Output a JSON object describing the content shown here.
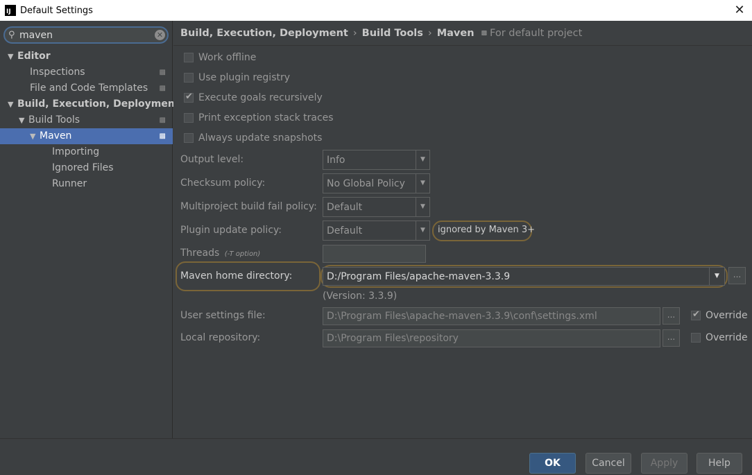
{
  "window": {
    "title": "Default Settings",
    "app_icon": "IJ"
  },
  "search": {
    "value": "maven"
  },
  "tree": [
    {
      "label": "Editor",
      "arrow": "▼",
      "bold": true,
      "indent": 0,
      "proj": false,
      "selected": false
    },
    {
      "label": "Inspections",
      "arrow": "",
      "bold": false,
      "indent": 2,
      "proj": true,
      "selected": false
    },
    {
      "label": "File and Code Templates",
      "arrow": "",
      "bold": false,
      "indent": 2,
      "proj": true,
      "selected": false
    },
    {
      "label": "Build, Execution, Deployment",
      "arrow": "▼",
      "bold": true,
      "indent": 0,
      "proj": false,
      "selected": false
    },
    {
      "label": "Build Tools",
      "arrow": "▼",
      "bold": false,
      "indent": 1,
      "proj": true,
      "selected": false
    },
    {
      "label": "Maven",
      "arrow": "▼",
      "bold": false,
      "indent": 2,
      "proj": true,
      "selected": true
    },
    {
      "label": "Importing",
      "arrow": "",
      "bold": false,
      "indent": 4,
      "proj": false,
      "selected": false
    },
    {
      "label": "Ignored Files",
      "arrow": "",
      "bold": false,
      "indent": 4,
      "proj": false,
      "selected": false
    },
    {
      "label": "Runner",
      "arrow": "",
      "bold": false,
      "indent": 4,
      "proj": false,
      "selected": false
    }
  ],
  "breadcrumb": {
    "part1": "Build, Execution, Deployment",
    "sep": "›",
    "part2": "Build Tools",
    "part3": "Maven",
    "scope": "For default project"
  },
  "checkboxes": {
    "work_offline": {
      "label": "Work offline",
      "checked": false
    },
    "use_plugin_registry": {
      "label": "Use plugin registry",
      "checked": false
    },
    "execute_goals": {
      "label": "Execute goals recursively",
      "checked": true
    },
    "print_exception": {
      "label": "Print exception stack traces",
      "checked": false
    },
    "always_update": {
      "label": "Always update snapshots",
      "checked": false
    }
  },
  "form": {
    "output_level": {
      "label": "Output level:",
      "value": "Info"
    },
    "checksum_policy": {
      "label": "Checksum policy:",
      "value": "No Global Policy"
    },
    "multiproject_fail": {
      "label": "Multiproject build fail policy:",
      "value": "Default"
    },
    "plugin_update": {
      "label": "Plugin update policy:",
      "value": "Default",
      "note": "ignored by Maven 3+"
    },
    "threads": {
      "label": "Threads",
      "hint": "(-T option)",
      "value": ""
    },
    "maven_home": {
      "label": "Maven home directory:",
      "value": "D:/Program Files/apache-maven-3.3.9",
      "version": "(Version: 3.3.9)"
    },
    "user_settings": {
      "label": "User settings file:",
      "value": "D:\\Program Files\\apache-maven-3.3.9\\conf\\settings.xml",
      "override_label": "Override",
      "override_checked": true
    },
    "local_repo": {
      "label": "Local repository:",
      "value": "D:\\Program Files\\repository",
      "override_label": "Override",
      "override_checked": false
    }
  },
  "buttons": {
    "ok": "OK",
    "cancel": "Cancel",
    "apply": "Apply",
    "help": "Help"
  },
  "dots": "...",
  "colors": {
    "selection": "#4b6eaf",
    "highlight": "#7a6538",
    "primary_button": "#365880"
  }
}
